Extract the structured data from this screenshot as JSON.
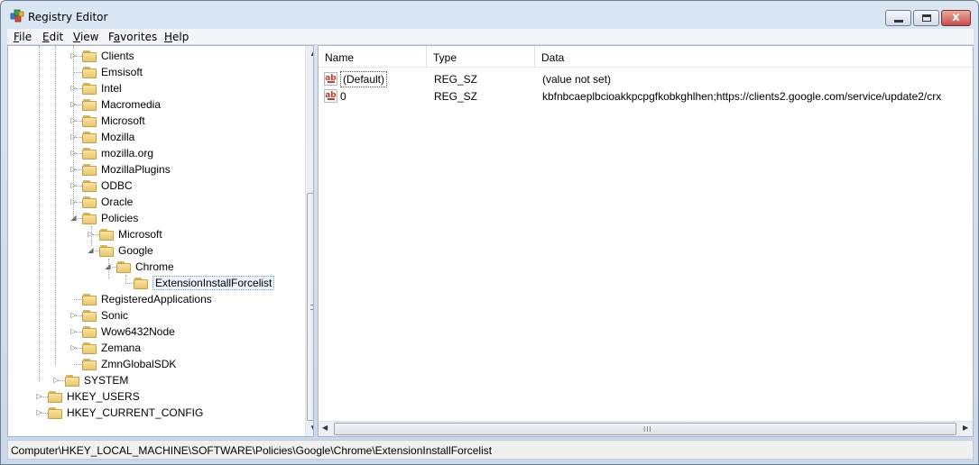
{
  "window": {
    "title": "Registry Editor",
    "close_glyph": "x"
  },
  "menu": [
    {
      "accel": "F",
      "rest": "ile"
    },
    {
      "accel": "E",
      "rest": "dit"
    },
    {
      "accel": "V",
      "rest": "iew"
    },
    {
      "pre": "F",
      "accel": "a",
      "rest": "vorites"
    },
    {
      "accel": "H",
      "rest": "elp"
    }
  ],
  "tree": {
    "nodes": [
      {
        "label": "Clients",
        "expander": "▷"
      },
      {
        "label": "Emsisoft",
        "expander": ""
      },
      {
        "label": "Intel",
        "expander": "▷"
      },
      {
        "label": "Macromedia",
        "expander": "▷"
      },
      {
        "label": "Microsoft",
        "expander": "▷"
      },
      {
        "label": "Mozilla",
        "expander": "▷"
      },
      {
        "label": "mozilla.org",
        "expander": "▷"
      },
      {
        "label": "MozillaPlugins",
        "expander": "▷"
      },
      {
        "label": "ODBC",
        "expander": "▷"
      },
      {
        "label": "Oracle",
        "expander": "▷"
      },
      {
        "label": "Policies",
        "expander": "◢"
      },
      {
        "label": "Microsoft",
        "expander": "▷"
      },
      {
        "label": "Google",
        "expander": "◢"
      },
      {
        "label": "Chrome",
        "expander": "◢"
      },
      {
        "label": "ExtensionInstallForcelist",
        "expander": ""
      },
      {
        "label": "RegisteredApplications",
        "expander": ""
      },
      {
        "label": "Sonic",
        "expander": "▷"
      },
      {
        "label": "Wow6432Node",
        "expander": "▷"
      },
      {
        "label": "Zemana",
        "expander": "▷"
      },
      {
        "label": "ZmnGlobalSDK",
        "expander": ""
      },
      {
        "label": "SYSTEM",
        "expander": "▷"
      },
      {
        "label": "HKEY_USERS",
        "expander": "▷"
      },
      {
        "label": "HKEY_CURRENT_CONFIG",
        "expander": "▷"
      }
    ],
    "selected": "ExtensionInstallForcelist"
  },
  "list": {
    "columns": [
      "Name",
      "Type",
      "Data"
    ],
    "rows": [
      {
        "icon": "string-value-icon",
        "name": "(Default)",
        "type": "REG_SZ",
        "data": "(value not set)"
      },
      {
        "icon": "string-value-icon",
        "name": "0",
        "type": "REG_SZ",
        "data": "kbfnbcaeplbcioakkpcpgfkobkghlhen;https://clients2.google.com/service/update2/crx"
      }
    ],
    "icon_text": "ab"
  },
  "scroll": {
    "up": "▲",
    "down": "▼",
    "left": "◀",
    "right": "▶",
    "grip_h": "III"
  },
  "status": {
    "path": "Computer\\HKEY_LOCAL_MACHINE\\SOFTWARE\\Policies\\Google\\Chrome\\ExtensionInstallForcelist"
  }
}
